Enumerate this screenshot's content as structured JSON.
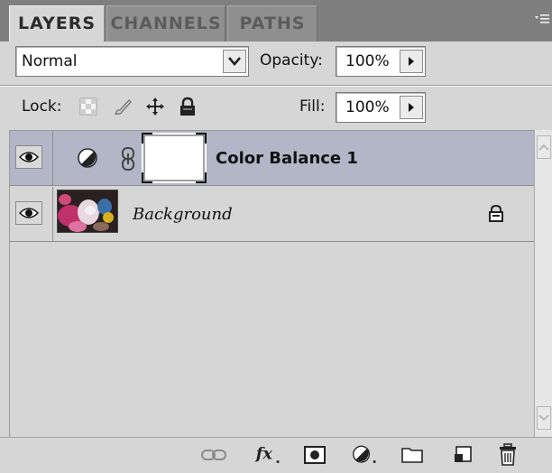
{
  "tabs": [
    {
      "label": "LAYERS",
      "active": true
    },
    {
      "label": "CHANNELS",
      "active": false
    },
    {
      "label": "PATHS",
      "active": false
    }
  ],
  "panel_menu_icon": "panel-menu-icon",
  "blend_mode": {
    "value": "Normal"
  },
  "opacity": {
    "label": "Opacity:",
    "value": "100%"
  },
  "lock": {
    "label": "Lock:",
    "icons": [
      "lock-transparent-pixels-icon",
      "lock-image-pixels-icon",
      "lock-position-icon",
      "lock-all-icon"
    ]
  },
  "fill": {
    "label": "Fill:",
    "value": "100%"
  },
  "layers": [
    {
      "name": "Color Balance 1",
      "type": "adjustment",
      "visible": true,
      "selected": true
    },
    {
      "name": "Background",
      "type": "image",
      "visible": true,
      "selected": false,
      "locked": true
    }
  ],
  "bottom_icons": [
    "link-layers-icon",
    "layer-style-fx-icon",
    "add-mask-icon",
    "new-adjustment-layer-icon",
    "new-group-folder-icon",
    "new-layer-icon",
    "delete-trash-icon"
  ],
  "colors": {
    "selected_row": "#b3b6c7",
    "panel_bg": "#d6d6d6",
    "tabbar_bg": "#7f7f7f"
  }
}
